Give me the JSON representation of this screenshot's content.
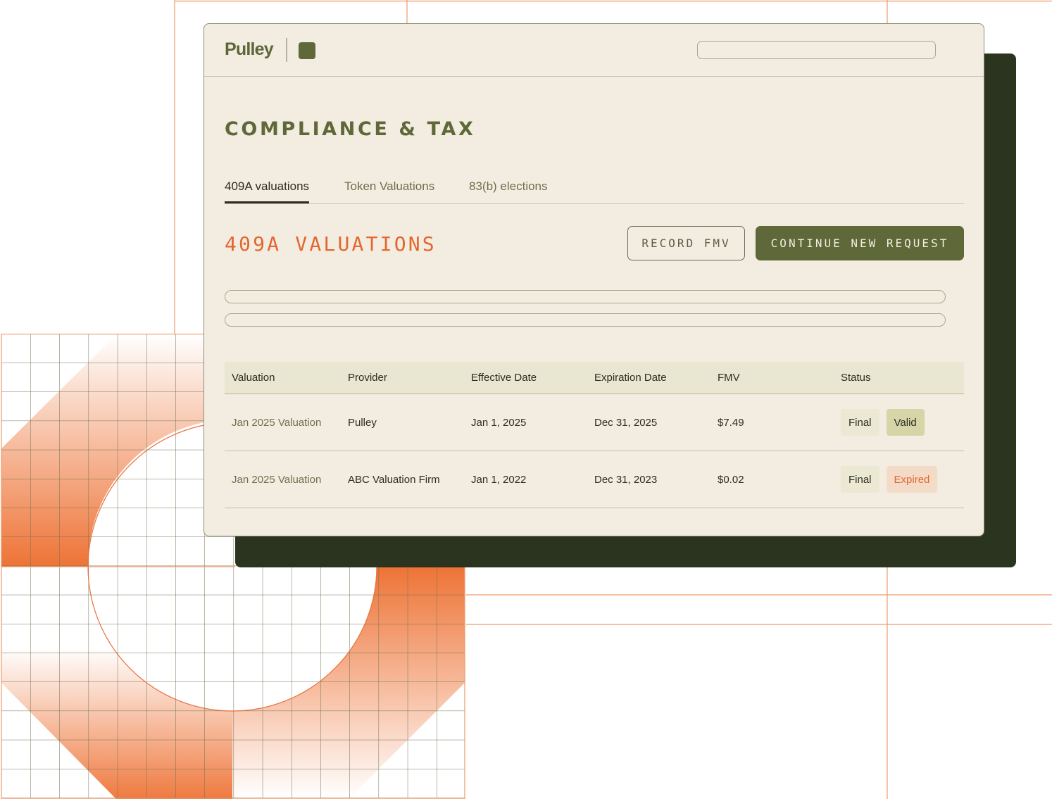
{
  "app": {
    "logo": "Pulley"
  },
  "search": {
    "placeholder": ""
  },
  "page": {
    "title": "COMPLIANCE & TAX"
  },
  "tabs": [
    {
      "label": "409A valuations",
      "active": true
    },
    {
      "label": "Token Valuations",
      "active": false
    },
    {
      "label": "83(b) elections",
      "active": false
    }
  ],
  "section": {
    "title": "409A VALUATIONS",
    "record_button": "RECORD FMV",
    "continue_button": "CONTINUE NEW REQUEST"
  },
  "table": {
    "headers": [
      "Valuation",
      "Provider",
      "Effective Date",
      "Expiration Date",
      "FMV",
      "Status"
    ],
    "rows": [
      {
        "valuation": "Jan 2025 Valuation",
        "provider": "Pulley",
        "effective": "Jan 1, 2025",
        "expiration": "Dec 31, 2025",
        "fmv": "$7.49",
        "status_type": "Final",
        "status_state": "Valid"
      },
      {
        "valuation": "Jan 2025 Valuation",
        "provider": "ABC Valuation Firm",
        "effective": "Jan 1, 2022",
        "expiration": "Dec 31, 2023",
        "fmv": "$0.02",
        "status_type": "Final",
        "status_state": "Expired"
      }
    ]
  },
  "colors": {
    "accent_orange": "#e3672e",
    "brand_olive": "#5f6838",
    "dark_green": "#2a341e",
    "window_bg": "#f3ece1"
  }
}
